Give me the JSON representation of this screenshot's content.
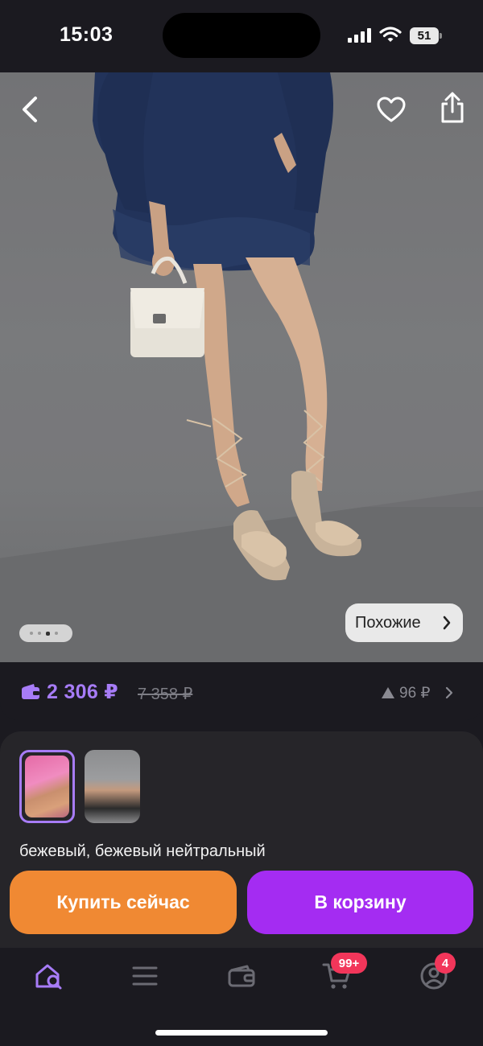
{
  "status_bar": {
    "time": "15:03",
    "battery": "51",
    "icons": [
      "signal-icon",
      "wifi-icon",
      "battery-icon"
    ]
  },
  "photo": {
    "carousel": {
      "count": 4,
      "active_index": 2
    },
    "similar_label": "Похожие",
    "icons": [
      "back-arrow-icon",
      "heart-icon",
      "share-icon",
      "chevron-right-icon"
    ]
  },
  "price": {
    "current": "2 306 ₽",
    "old": "7 358 ₽",
    "difference": "96 ₽",
    "current_color": "#a77cf7",
    "icons": [
      "wallet-icon",
      "triangle-up-icon",
      "chevron-right-icon"
    ]
  },
  "variants": {
    "selected_index": 0,
    "color_label": "бежевый, бежевый нейтральный"
  },
  "actions": {
    "buy_now": "Купить сейчас",
    "add_to_cart": "В корзину",
    "buy_color": "#f08933",
    "cart_color": "#a42cf2"
  },
  "tab_bar": {
    "items": [
      {
        "name": "home-search",
        "icon": "home-search-icon",
        "active": true
      },
      {
        "name": "catalog",
        "icon": "menu-icon",
        "active": false
      },
      {
        "name": "wallet",
        "icon": "wallet-icon",
        "active": false
      },
      {
        "name": "cart",
        "icon": "cart-icon",
        "active": false
      },
      {
        "name": "profile",
        "icon": "profile-icon",
        "active": false
      }
    ],
    "cart_badge": "99+",
    "profile_badge": "4",
    "active_color": "#a77cf7",
    "badge_color": "#f2365a"
  }
}
